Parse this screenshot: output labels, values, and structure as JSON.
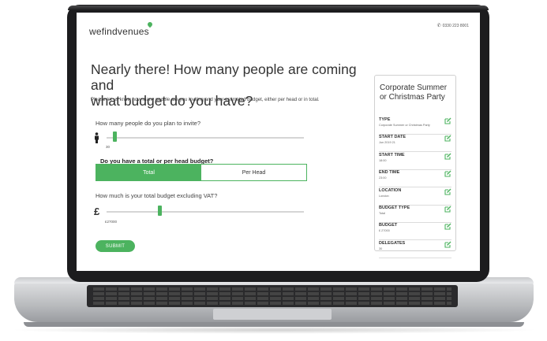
{
  "header": {
    "logo_text": "wefindvenues",
    "phone_text": "0330 223 8001"
  },
  "main": {
    "headline_line1": "Nearly there! How many people are coming and",
    "headline_line2": "what budget do you have?",
    "subtitle": "Please let us know how many people are you inviting and your estimated budget, either per head or in total.",
    "people_question": "How many people do you plan to invite?",
    "people_value": "30",
    "people_slider_fraction": 0.04,
    "budget_type_question": "Do you have a total or per head budget?",
    "toggle_options": [
      "Total",
      "Per Head"
    ],
    "toggle_selected": "Total",
    "budget_question": "How much is your total budget excluding VAT?",
    "currency_symbol": "£",
    "budget_value": "£27000",
    "budget_slider_fraction": 0.27,
    "submit_label": "SUBMIT"
  },
  "summary": {
    "title_line1": "Corporate Summer",
    "title_line2": "or Christmas Party",
    "rows": [
      {
        "label": "TYPE",
        "value": "Corporate Summer or Christmas Party"
      },
      {
        "label": "START DATE",
        "value": "Jun 2019 21"
      },
      {
        "label": "START TIME",
        "value": "18:00"
      },
      {
        "label": "END TIME",
        "value": "23:00"
      },
      {
        "label": "LOCATION",
        "value": "London"
      },
      {
        "label": "BUDGET TYPE",
        "value": "Total"
      },
      {
        "label": "BUDGET",
        "value": "£ 27000"
      },
      {
        "label": "DELEGATES",
        "value": "30"
      }
    ]
  },
  "colors": {
    "accent": "#4cb35f",
    "laptop_frame": "#1c1c1e"
  }
}
